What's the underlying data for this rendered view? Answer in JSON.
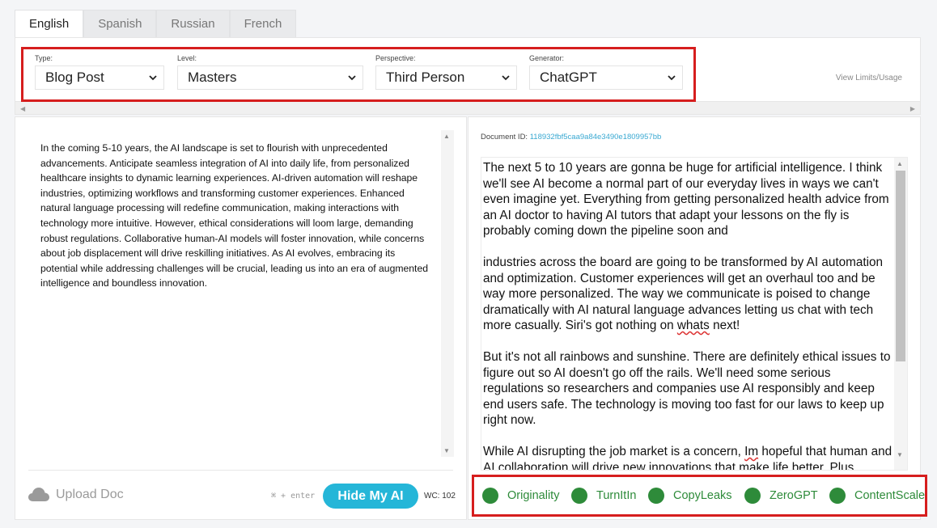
{
  "tabs": [
    "English",
    "Spanish",
    "Russian",
    "French"
  ],
  "settings": {
    "type_label": "Type:",
    "type_value": "Blog Post",
    "level_label": "Level:",
    "level_value": "Masters",
    "perspective_label": "Perspective:",
    "perspective_value": "Third Person",
    "generator_label": "Generator:",
    "generator_value": "ChatGPT",
    "view_limits": "View Limits/Usage"
  },
  "input_text": "In the coming 5-10 years, the AI landscape is set to flourish with unprecedented advancements. Anticipate seamless integration of AI into daily life, from personalized healthcare insights to dynamic learning experiences. AI-driven automation will reshape industries, optimizing workflows and transforming customer experiences. Enhanced natural language processing will redefine communication, making interactions with technology more intuitive. However, ethical considerations will loom large, demanding robust regulations. Collaborative human-AI models will foster innovation, while concerns about job displacement will drive reskilling initiatives. As AI evolves, embracing its potential while addressing challenges will be crucial, leading us into an era of augmented intelligence and boundless innovation.",
  "bottom_bar": {
    "upload_label": "Upload Doc",
    "shortcut": "⌘ + enter",
    "hide_button": "Hide My AI",
    "word_count": "WC: 102"
  },
  "document": {
    "id_label": "Document ID:",
    "id_value": "118932fbf5caa9a84e3490e1809957bb"
  },
  "output": {
    "p1": "The next 5 to 10 years are gonna be huge for artificial intelligence.  I think we'll see AI become a normal part of our everyday lives in ways we can't even imagine yet.  Everything from getting personalized health advice from an AI doctor to having AI tutors that adapt your lessons on the fly is probably coming down the pipeline soon and",
    "p2a": "industries across the board are going to be transformed by AI automation and optimization.  Customer experiences will get an overhaul too and be way more personalized.  The way we communicate is poised to change dramatically with AI natural language advances letting us chat with tech more casually.  Siri's got nothing on ",
    "p2b": "whats",
    "p2c": " next!",
    "p3": "But it's not all rainbows and sunshine.  There are definitely ethical issues to figure out so AI doesn't go off the rails.  We'll need some serious regulations so researchers and companies use AI responsibly and keep end users safe.  The technology is moving too fast for our laws to keep up right now.",
    "p4a": "While AI disrupting the job market is a concern, ",
    "p4b": "Im",
    "p4c": " hopeful that human and AI collaboration will drive new innovations that make life better.  Plus"
  },
  "detectors": [
    "Originality",
    "TurnItIn",
    "CopyLeaks",
    "ZeroGPT",
    "ContentScale"
  ],
  "colors": {
    "accent": "#25b6d8",
    "detector_green": "#2e8b3a",
    "highlight_red": "#d61e1e",
    "link_blue": "#3aa9d2"
  }
}
